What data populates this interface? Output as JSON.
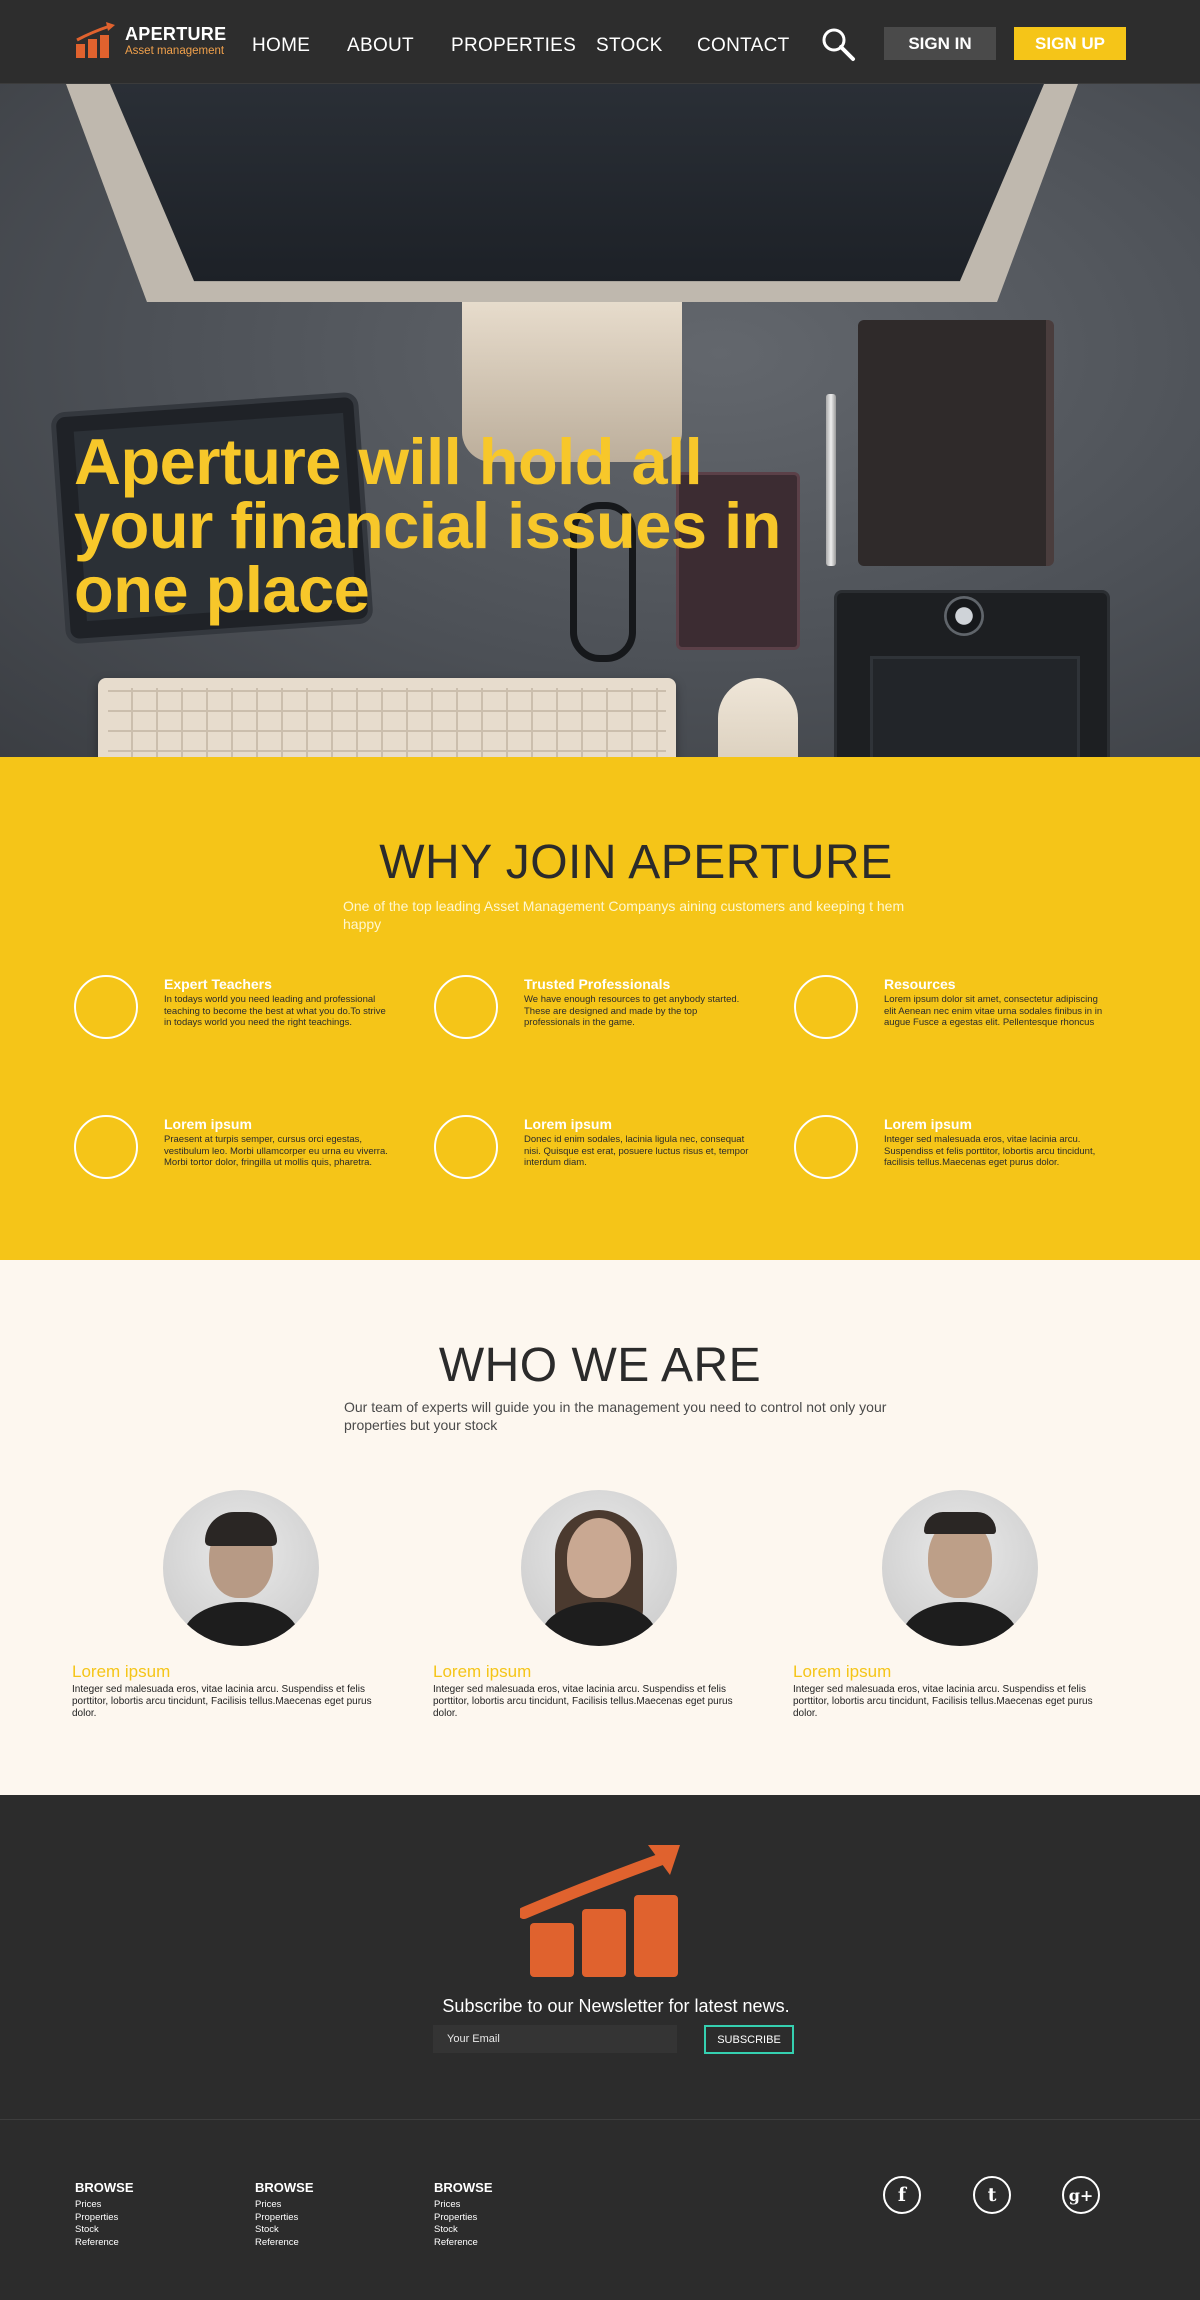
{
  "header": {
    "brand_name": "APERTURE",
    "brand_tagline": "Asset management",
    "nav": [
      "HOME",
      "ABOUT",
      "PROPERTIES",
      "STOCK",
      "CONTACT"
    ],
    "sign_in": "SIGN IN",
    "sign_up": "SIGN UP",
    "search_icon": "magnifier"
  },
  "hero": {
    "title": "Aperture will hold all your financial issues in one place"
  },
  "why": {
    "title": "WHY JOIN APERTURE",
    "subtitle": "One of the top leading Asset Management Companys aining customers and keeping t hem happy",
    "features": [
      {
        "title": "Expert Teachers",
        "text": "In todays world you need leading and professional teaching to become the best at what you do.To strive in todays world you need the right teachings."
      },
      {
        "title": "Trusted Professionals",
        "text": "We have enough resources to get anybody started. These are designed and made by the top professionals in the game."
      },
      {
        "title": "Resources",
        "text": "Lorem ipsum dolor sit amet, consectetur adipiscing elit Aenean nec enim vitae urna sodales finibus in in augue Fusce a egestas elit. Pellentesque rhoncus"
      },
      {
        "title": "Lorem ipsum",
        "text": "Praesent at turpis semper, cursus orci egestas, vestibulum leo. Morbi ullamcorper eu urna eu viverra. Morbi tortor dolor, fringilla ut mollis quis, pharetra."
      },
      {
        "title": "Lorem ipsum",
        "text": "Donec id enim sodales, lacinia ligula nec, consequat nisi. Quisque est erat, posuere luctus risus et, tempor interdum diam."
      },
      {
        "title": "Lorem ipsum",
        "text": "Integer sed malesuada eros, vitae lacinia arcu. Suspendiss et felis porttitor, lobortis arcu tincidunt, facilisis tellus.Maecenas eget purus dolor."
      }
    ]
  },
  "who": {
    "title": "WHO WE ARE",
    "subtitle": "Our team of experts will guide you in the management you need to control not only your properties but your stock",
    "members": [
      {
        "name": "Lorem ipsum",
        "text": "Integer sed malesuada eros, vitae lacinia arcu. Suspendiss et felis porttitor, lobortis arcu tincidunt, Facilisis tellus.Maecenas eget purus dolor."
      },
      {
        "name": "Lorem ipsum",
        "text": "Integer sed malesuada eros, vitae lacinia arcu. Suspendiss et felis porttitor, lobortis arcu tincidunt, Facilisis tellus.Maecenas eget purus dolor."
      },
      {
        "name": "Lorem ipsum",
        "text": "Integer sed malesuada eros, vitae lacinia arcu. Suspendiss et felis porttitor, lobortis arcu tincidunt, Facilisis tellus.Maecenas eget purus dolor."
      }
    ]
  },
  "newsletter": {
    "title": "Subscribe to our Newsletter for latest news.",
    "email_placeholder": "Your Email",
    "button": "SUBSCRIBE"
  },
  "footer": {
    "columns": [
      {
        "heading": "BROWSE",
        "links": [
          "Prices",
          "Properties",
          "Stock",
          "Reference"
        ]
      },
      {
        "heading": "BROWSE",
        "links": [
          "Prices",
          "Properties",
          "Stock",
          "Reference"
        ]
      },
      {
        "heading": "BROWSE",
        "links": [
          "Prices",
          "Properties",
          "Stock",
          "Reference"
        ]
      }
    ],
    "social": [
      {
        "icon": "facebook-icon",
        "glyph": "f"
      },
      {
        "icon": "twitter-icon",
        "glyph": "t"
      },
      {
        "icon": "googleplus-icon",
        "glyph": "g+"
      }
    ]
  },
  "colors": {
    "accent_yellow": "#f5c518",
    "brand_orange": "#e0622e",
    "dark_bg": "#2c2c2c",
    "cream_bg": "#fdf7ef",
    "subscribe_border": "#35d0b0"
  }
}
